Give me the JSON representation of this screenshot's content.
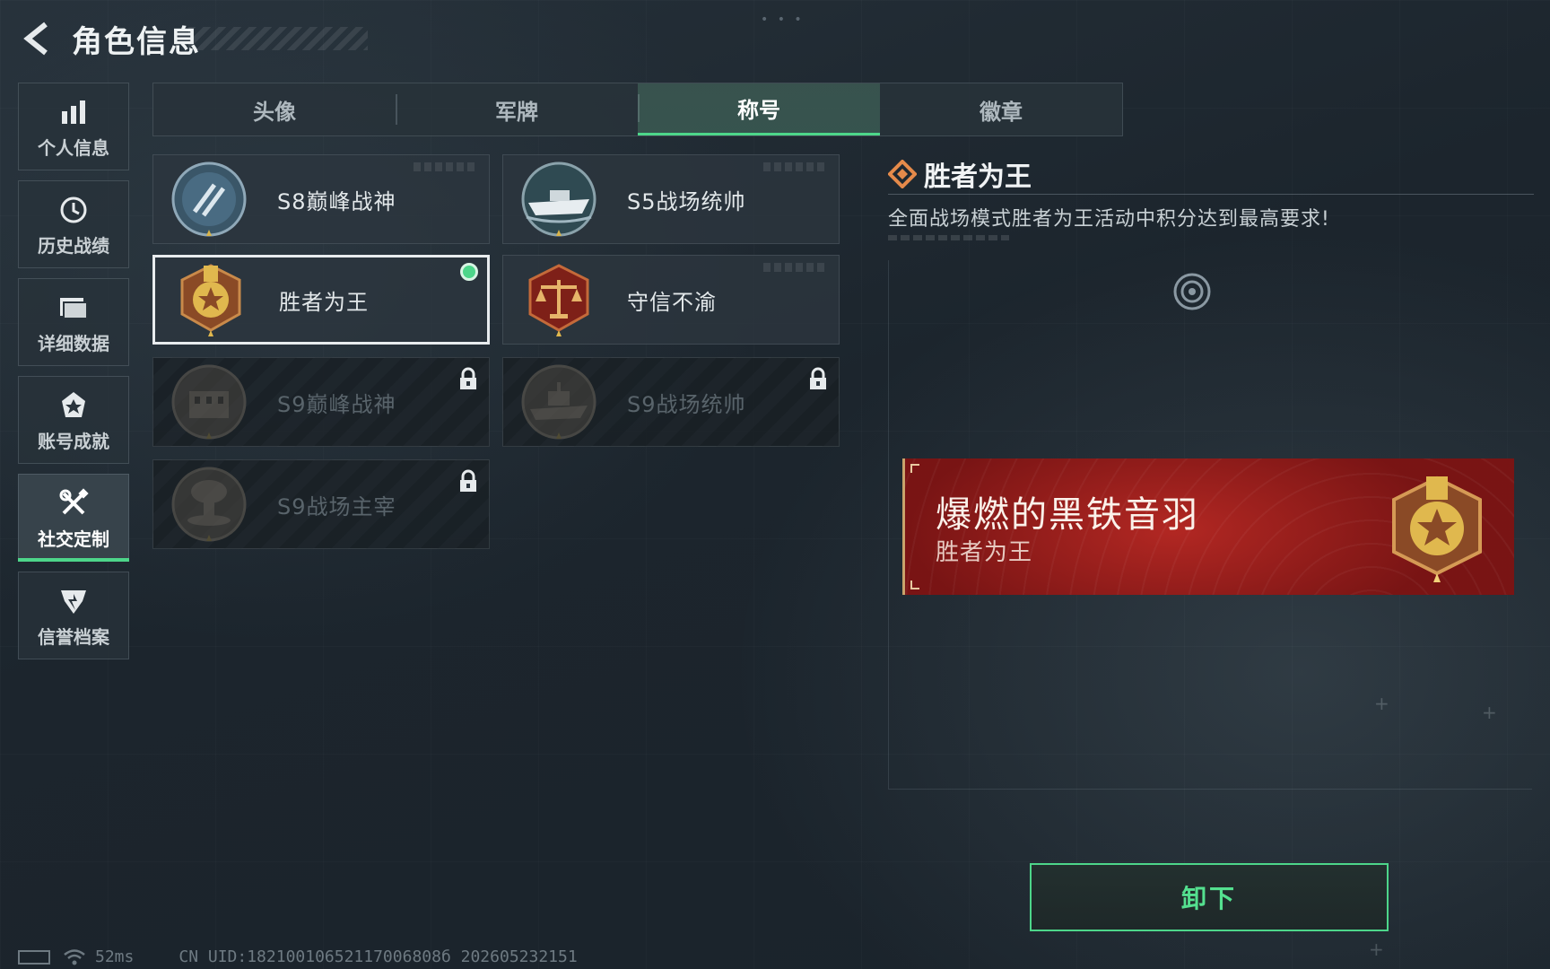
{
  "header": {
    "title": "角色信息",
    "back_icon": "back-arrow-icon"
  },
  "sidebar": {
    "items": [
      {
        "label": "个人信息",
        "icon": "bar-chart-icon",
        "active": false
      },
      {
        "label": "历史战绩",
        "icon": "clock-history-icon",
        "active": false
      },
      {
        "label": "详细数据",
        "icon": "folder-icon",
        "active": false
      },
      {
        "label": "账号成就",
        "icon": "medal-icon",
        "active": false
      },
      {
        "label": "社交定制",
        "icon": "tools-icon",
        "active": true
      },
      {
        "label": "信誉档案",
        "icon": "shield-icon",
        "active": false
      }
    ]
  },
  "tabs": [
    {
      "label": "头像",
      "active": false
    },
    {
      "label": "军牌",
      "active": false
    },
    {
      "label": "称号",
      "active": true
    },
    {
      "label": "徽章",
      "active": false
    }
  ],
  "titles": [
    {
      "label": "S8巅峰战神",
      "locked": false,
      "selected": false,
      "badge": "blue-emblem-icon"
    },
    {
      "label": "S5战场统帅",
      "locked": false,
      "selected": false,
      "badge": "boat-emblem-icon"
    },
    {
      "label": "胜者为王",
      "locked": false,
      "selected": true,
      "badge": "gold-medal-icon"
    },
    {
      "label": "守信不渝",
      "locked": false,
      "selected": false,
      "badge": "scales-emblem-icon"
    },
    {
      "label": "S9巅峰战神",
      "locked": true,
      "selected": false,
      "badge": "fortress-emblem-icon"
    },
    {
      "label": "S9战场统帅",
      "locked": true,
      "selected": false,
      "badge": "warship-emblem-icon"
    },
    {
      "label": "S9战场主宰",
      "locked": true,
      "selected": false,
      "badge": "mushroom-cloud-emblem-icon"
    }
  ],
  "detail": {
    "title": "胜者为王",
    "description": "全面战场模式胜者为王活动中积分达到最高要求!"
  },
  "nameplate": {
    "player_name": "爆燃的黑铁音羽",
    "title": "胜者为王"
  },
  "actions": {
    "unequip_label": "卸下"
  },
  "footer": {
    "ping": "52ms",
    "uid": "CN UID:18210010652117006808б 202605232151"
  },
  "colors": {
    "accent_green": "#4dd68a",
    "nameplate_red": "#8e1e1c",
    "gold": "#c9a36b"
  }
}
